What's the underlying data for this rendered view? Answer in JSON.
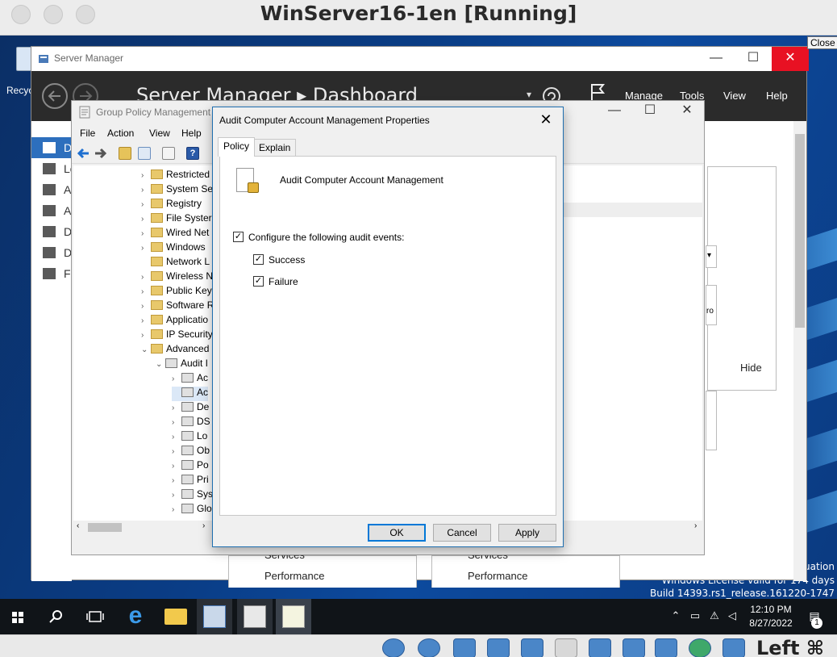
{
  "host": {
    "title": "WinServer16-1en [Running]",
    "key_label": "Left ⌘"
  },
  "desktop": {
    "recycle_label": "Recyc",
    "close_tooltip": "Close",
    "watermark": {
      "line1": "uation",
      "line2": "Windows License valid for 174 days",
      "line3": "Build 14393.rs1_release.161220-1747"
    }
  },
  "server_manager": {
    "title": "Server Manager",
    "breadcrumb": "Server Manager ▸ Dashboard",
    "menu": [
      "Manage",
      "Tools",
      "View",
      "Help"
    ],
    "nav": [
      {
        "label": "D",
        "icon": "dashboard-icon"
      },
      {
        "label": "Lo",
        "icon": "local-server-icon"
      },
      {
        "label": "Al",
        "icon": "all-servers-icon"
      },
      {
        "label": "Al",
        "icon": "ad-icon"
      },
      {
        "label": "D",
        "icon": "dns-icon"
      },
      {
        "label": "D",
        "icon": "dhcp-icon"
      },
      {
        "label": "Fi",
        "icon": "file-services-icon"
      }
    ],
    "hide_label": "Hide",
    "tile_texts": {
      "services_1": "Services",
      "services_2": "Services",
      "performance_1": "Performance",
      "performance_2": "Performance",
      "fragment": "ro"
    }
  },
  "gpm": {
    "title": "Group Policy Management",
    "menu": [
      "File",
      "Action",
      "View",
      "Help"
    ],
    "tree": [
      {
        "label": "Restricted",
        "indent": 0,
        "arrow": ">",
        "policy": false
      },
      {
        "label": "System Se",
        "indent": 0,
        "arrow": ">",
        "policy": false
      },
      {
        "label": "Registry",
        "indent": 0,
        "arrow": ">",
        "policy": false
      },
      {
        "label": "File Syster",
        "indent": 0,
        "arrow": ">",
        "policy": false
      },
      {
        "label": "Wired Net",
        "indent": 0,
        "arrow": ">",
        "policy": false
      },
      {
        "label": "Windows",
        "indent": 0,
        "arrow": ">",
        "policy": false
      },
      {
        "label": "Network L",
        "indent": 0,
        "arrow": "",
        "policy": false
      },
      {
        "label": "Wireless N",
        "indent": 0,
        "arrow": ">",
        "policy": false
      },
      {
        "label": "Public Key",
        "indent": 0,
        "arrow": ">",
        "policy": false
      },
      {
        "label": "Software R",
        "indent": 0,
        "arrow": ">",
        "policy": false
      },
      {
        "label": "Applicatio",
        "indent": 0,
        "arrow": ">",
        "policy": false
      },
      {
        "label": "IP Security",
        "indent": 0,
        "arrow": ">",
        "policy": false
      },
      {
        "label": "Advanced",
        "indent": 0,
        "arrow": "v",
        "policy": false
      },
      {
        "label": "Audit I",
        "indent": 1,
        "arrow": "v",
        "policy": true
      },
      {
        "label": "Ac",
        "indent": 2,
        "arrow": ">",
        "policy": true
      },
      {
        "label": "Ac",
        "indent": 2,
        "arrow": "",
        "policy": true
      },
      {
        "label": "De",
        "indent": 2,
        "arrow": ">",
        "policy": true
      },
      {
        "label": "DS",
        "indent": 2,
        "arrow": ">",
        "policy": true
      },
      {
        "label": "Lo",
        "indent": 2,
        "arrow": ">",
        "policy": true
      },
      {
        "label": "Ob",
        "indent": 2,
        "arrow": ">",
        "policy": true
      },
      {
        "label": "Po",
        "indent": 2,
        "arrow": ">",
        "policy": true
      },
      {
        "label": "Pri",
        "indent": 2,
        "arrow": ">",
        "policy": true
      },
      {
        "label": "Sys",
        "indent": 2,
        "arrow": ">",
        "policy": true
      },
      {
        "label": "Glo",
        "indent": 2,
        "arrow": ">",
        "policy": true
      }
    ]
  },
  "dialog": {
    "title": "Audit Computer Account Management Properties",
    "tabs": [
      "Policy",
      "Explain"
    ],
    "policy_name": "Audit Computer Account Management",
    "configure_label": "Configure the following audit events:",
    "configure_checked": true,
    "success_label": "Success",
    "success_checked": true,
    "failure_label": "Failure",
    "failure_checked": true,
    "buttons": {
      "ok": "OK",
      "cancel": "Cancel",
      "apply": "Apply"
    }
  },
  "taskbar": {
    "time": "12:10 PM",
    "date": "8/27/2022",
    "notification_count": "1"
  }
}
